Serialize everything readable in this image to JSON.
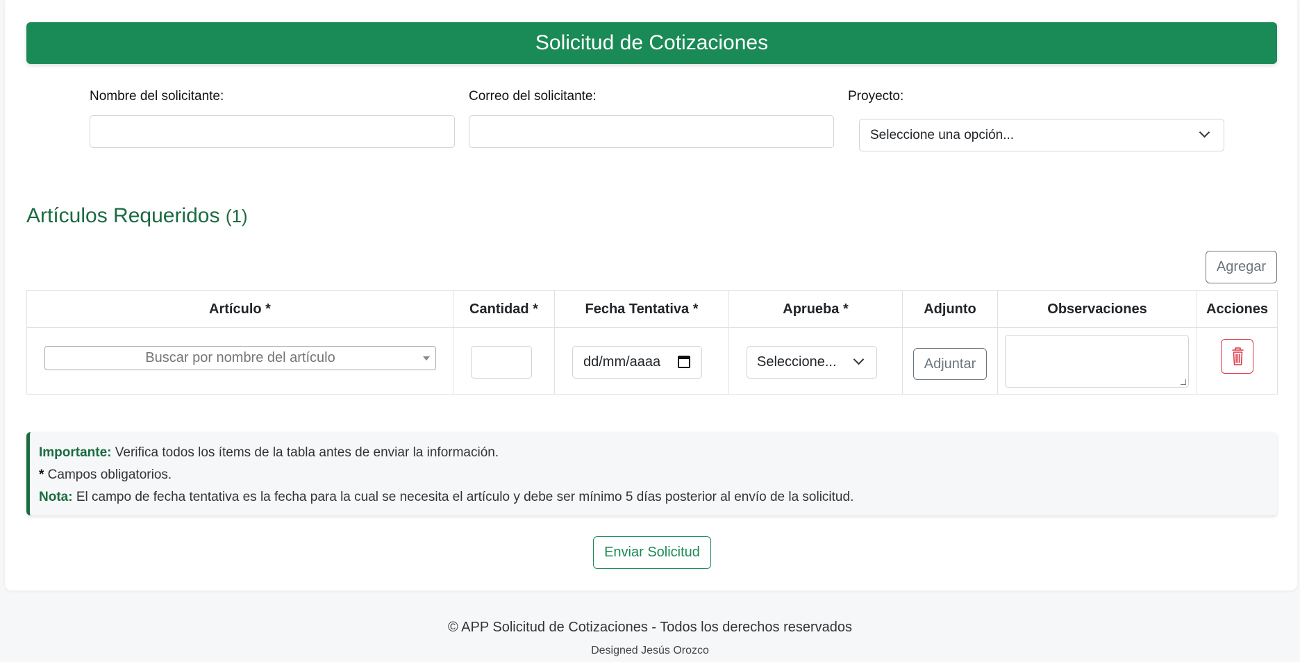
{
  "header": {
    "title": "Solicitud de Cotizaciones"
  },
  "form": {
    "name_label": "Nombre del solicitante:",
    "name_value": "",
    "email_label": "Correo del solicitante:",
    "email_value": "",
    "project_label": "Proyecto:",
    "project_selected": "Seleccione una opción..."
  },
  "items_section": {
    "title": "Artículos Requeridos",
    "count_text": "(1)",
    "add_label": "Agregar"
  },
  "table": {
    "columns": [
      "Artículo *",
      "Cantidad *",
      "Fecha Tentativa *",
      "Aprueba *",
      "Adjunto",
      "Observaciones",
      "Acciones"
    ],
    "row": {
      "article_placeholder": "Buscar por nombre del artículo",
      "quantity": "",
      "date_placeholder": "dd/mm/aaaa",
      "approver_selected": "Seleccione...",
      "attach_label": "Adjuntar",
      "observations": ""
    }
  },
  "notes": {
    "important_label": "Importante:",
    "important_text": " Verifica todos los ítems de la tabla antes de enviar la información.",
    "required_mark": "*",
    "required_text": " Campos obligatorios.",
    "note_label": "Nota:",
    "note_text": " El campo de fecha tentativa es la fecha para la cual se necesita el artículo y debe ser mínimo 5 días posterior al envío de la solicitud."
  },
  "submit_label": "Enviar Solicitud",
  "footer": {
    "copyright": "© APP Solicitud de Cotizaciones - Todos los derechos reservados",
    "designer": "Designed Jesús Orozco"
  },
  "colors": {
    "brand": "#1a8a56",
    "brand_dark": "#1a6b41",
    "danger": "#dc3545"
  },
  "icons": {
    "delete": "trash-icon",
    "calendar": "calendar-icon",
    "dropdown": "chevron-down-icon"
  }
}
